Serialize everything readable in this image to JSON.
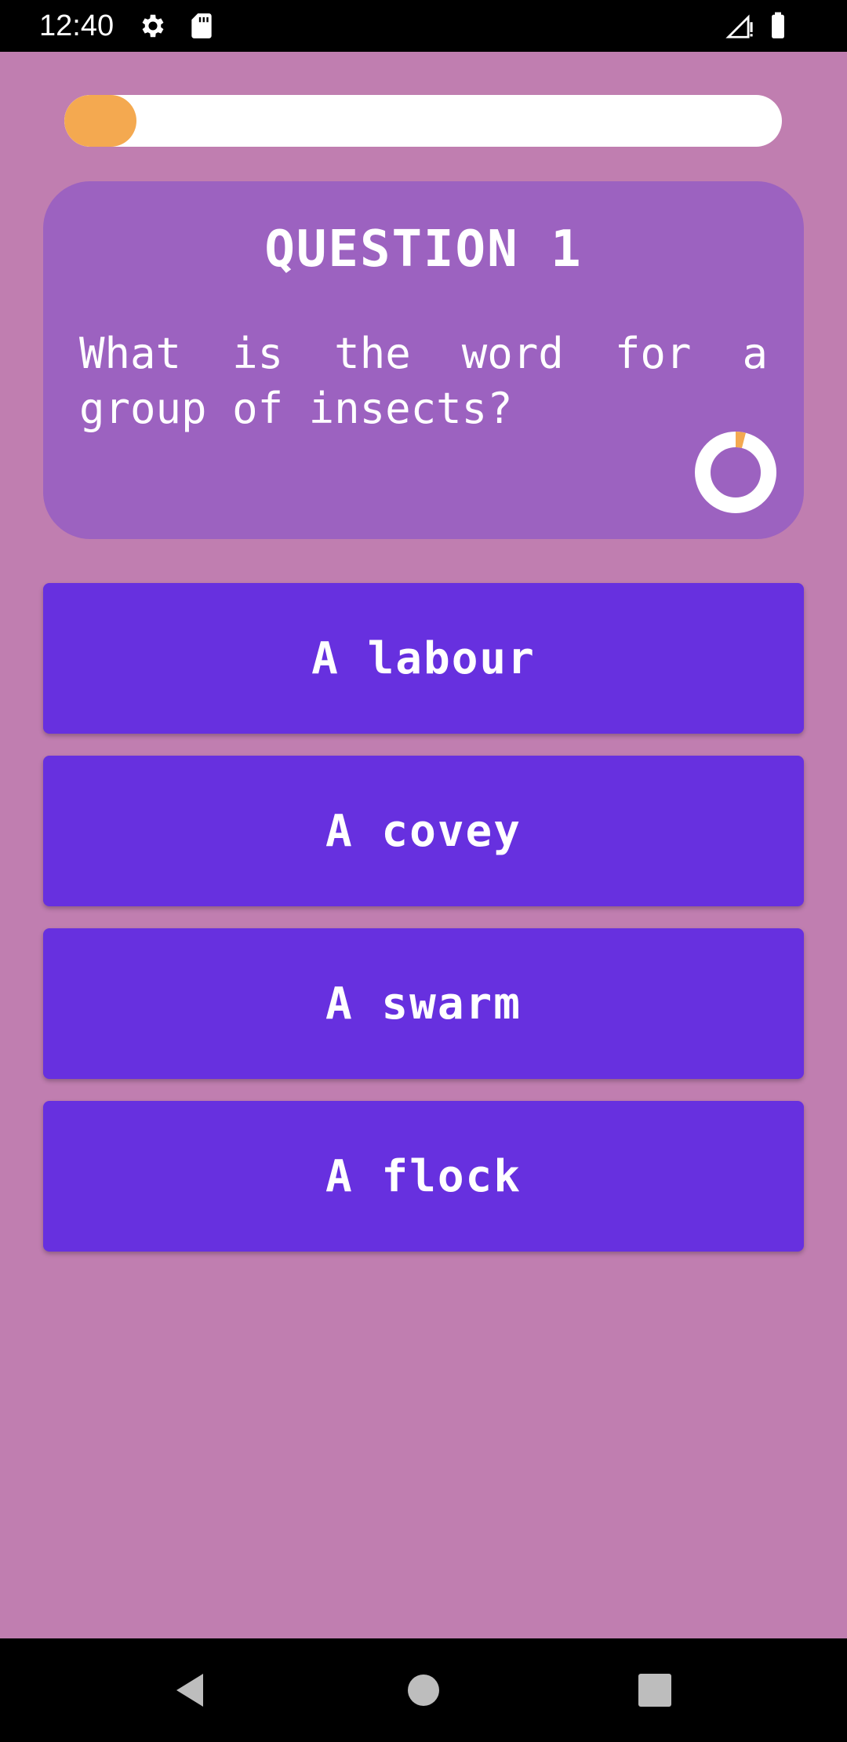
{
  "status_bar": {
    "time": "12:40",
    "icons": [
      "gear-icon",
      "sd-card-icon",
      "signal-icon",
      "battery-icon"
    ]
  },
  "quiz": {
    "progress_fraction": 0.1,
    "question_title": "QUESTION 1",
    "question_text": "What is the word for a group of insects?",
    "timer_fraction": 0.04,
    "answers": [
      "A labour",
      "A covey",
      "A swarm",
      "A flock"
    ]
  },
  "nav_bar": {
    "icons": [
      "back-icon",
      "home-icon",
      "recents-icon"
    ]
  },
  "colors": {
    "background": "#c07eb0",
    "card": "#9c62c0",
    "answer": "#6730df",
    "accent": "#f4a950"
  }
}
